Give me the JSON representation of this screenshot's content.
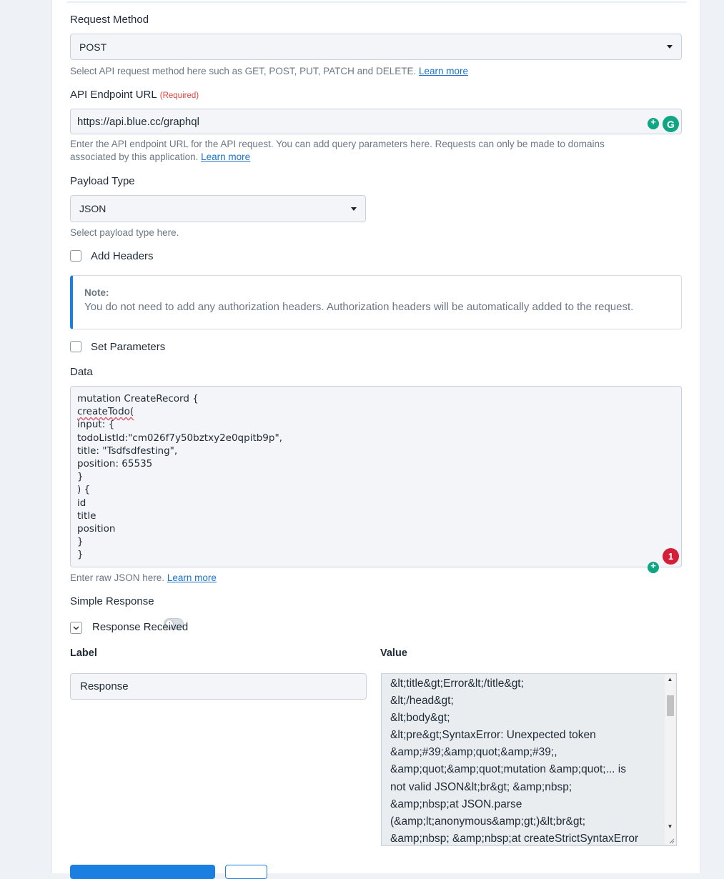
{
  "request_method": {
    "label": "Request Method",
    "value": "POST",
    "help_text": "Select API request method here such as GET, POST, PUT, PATCH and DELETE.",
    "learn_more": "Learn more"
  },
  "endpoint": {
    "label": "API Endpoint URL",
    "required": "(Required)",
    "value": "https://api.blue.cc/graphql",
    "help_line1": "Enter the API endpoint URL for the API request. You can add query parameters here. Requests can only be made to domains",
    "help_line2": "associated by this application.",
    "learn_more": "Learn more"
  },
  "payload_type": {
    "label": "Payload Type",
    "value": "JSON",
    "help_text": "Select payload type here."
  },
  "add_headers": {
    "label": "Add Headers",
    "checked": false
  },
  "note": {
    "title": "Note:",
    "text": "You do not need to add any authorization headers. Authorization headers will be automatically added to the request."
  },
  "set_parameters": {
    "label": "Set Parameters",
    "checked": false
  },
  "data": {
    "label": "Data",
    "lines": [
      "mutation CreateRecord {",
      "createTodo(",
      "input: {",
      "todoListId:\"cm026f7y50bztxy2e0qpitb9p\",",
      "title: \"Tsdfsdfesting\",",
      "position: 65535",
      "}",
      ") {",
      "id",
      "title",
      "position",
      "}",
      "}"
    ],
    "help_text": "Enter raw JSON here.",
    "learn_more": "Learn more",
    "grammarly_count": "1"
  },
  "simple_response": {
    "label": "Simple Response",
    "enabled": false
  },
  "response_received": {
    "label": "Response Received"
  },
  "response_table": {
    "label_header": "Label",
    "value_header": "Value",
    "label_value": "Response",
    "value_lines": [
      "&lt;title&gt;Error&lt;/title&gt;",
      "&lt;/head&gt;",
      "&lt;body&gt;",
      "&lt;pre&gt;SyntaxError: Unexpected token",
      "&amp;#39;&amp;quot;&amp;#39;,",
      "&amp;quot;&amp;quot;mutation &amp;quot;... is",
      "not valid JSON&lt;br&gt; &amp;nbsp;",
      "&amp;nbsp;at JSON.parse",
      "(&amp;lt;anonymous&amp;gt;)&lt;br&gt;",
      "&amp;nbsp; &amp;nbsp;at createStrictSyntaxError"
    ]
  },
  "colors": {
    "accent": "#1a7fe0",
    "link": "#1a73c9",
    "required": "#d9453f",
    "grammarly": "#11a683",
    "error_badge": "#d32038"
  },
  "icons": {
    "select_caret": "caret-down-icon",
    "grammarly": "grammarly-icon",
    "suggestion": "lightbulb-icon",
    "collapse": "chevron-down-icon"
  }
}
